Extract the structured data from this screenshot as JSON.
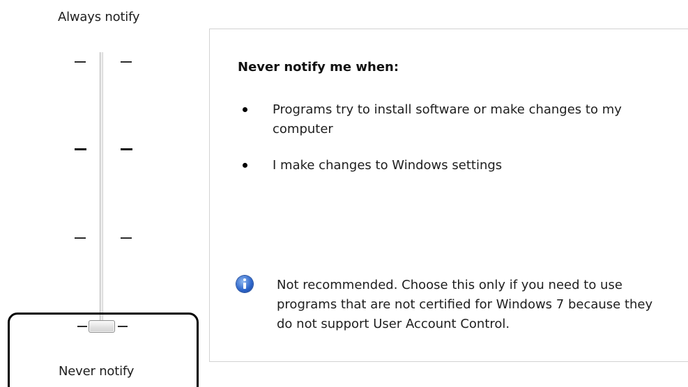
{
  "slider": {
    "top_label": "Always notify",
    "bottom_label": "Never notify",
    "levels": 4,
    "selected_level": 0
  },
  "panel": {
    "heading": "Never notify me when:",
    "bullets": [
      "Programs try to install software or make changes to my computer",
      "I make changes to Windows settings"
    ],
    "info_text": "Not recommended. Choose this only if you need to use programs that are not certified for Windows 7 because they do not support User Account Control."
  },
  "icons": {
    "info": "info-icon"
  }
}
